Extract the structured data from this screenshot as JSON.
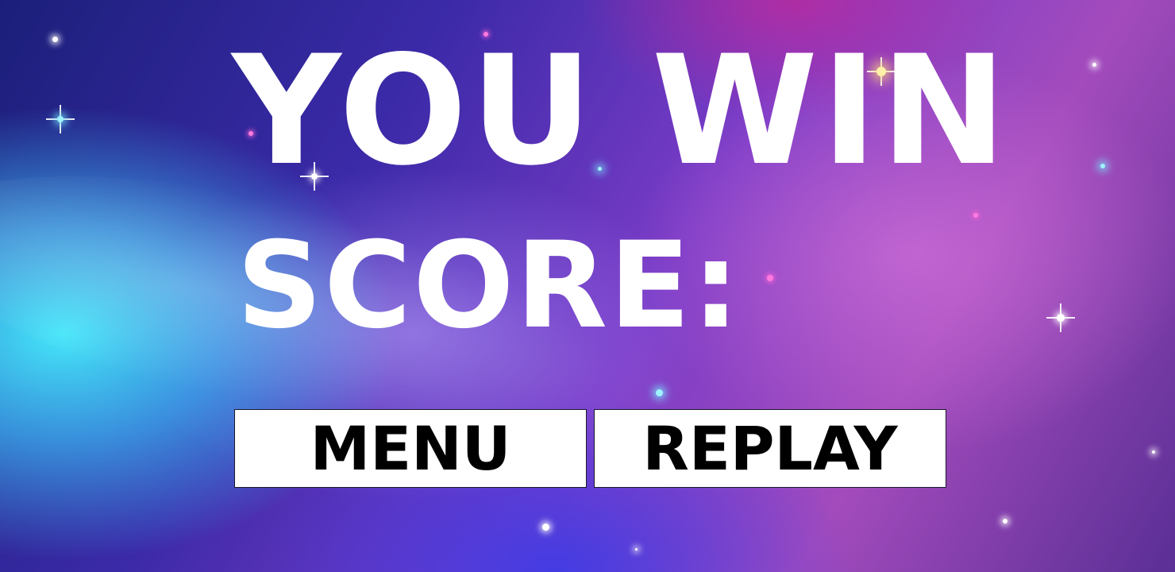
{
  "screen": {
    "title": "YOU WIN",
    "score_label": "SCORE:",
    "score_value": ""
  },
  "buttons": {
    "menu_label": "MENU",
    "replay_label": "REPLAY"
  },
  "colors": {
    "text": "#ffffff",
    "button_bg": "#ffffff",
    "button_text": "#000000"
  }
}
